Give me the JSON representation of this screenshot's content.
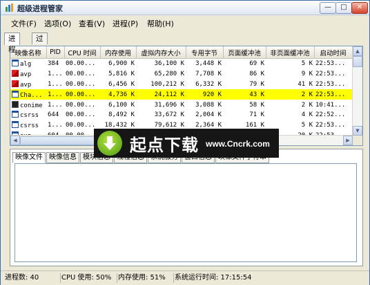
{
  "window": {
    "title": "超级进程管家"
  },
  "menu": [
    "文件(F)",
    "选项(O)",
    "查看(V)",
    "进程(P)",
    "帮助(H)"
  ],
  "tabs": [
    "进程",
    "过滤"
  ],
  "table": {
    "headers": [
      "映像名称",
      "PID",
      "CPU 时间",
      "内存使用",
      "虚拟内存大小",
      "专用字节",
      "页面缓冲池",
      "非页面缓冲池",
      "启动时间"
    ],
    "rows": [
      {
        "name": "alg",
        "pid": "384",
        "cpu": "00.00...",
        "mem": "6,900 K",
        "virt": "36,100 K",
        "priv": "3,448 K",
        "paged": "69 K",
        "nonpaged": "5 K",
        "start": "22:53...",
        "icon": "generic"
      },
      {
        "name": "avp",
        "pid": "1...",
        "cpu": "00.00...",
        "mem": "5,816 K",
        "virt": "65,280 K",
        "priv": "7,708 K",
        "paged": "86 K",
        "nonpaged": "9 K",
        "start": "22:53...",
        "icon": "avp"
      },
      {
        "name": "avp",
        "pid": "1...",
        "cpu": "00.00...",
        "mem": "6,456 K",
        "virt": "100,212 K",
        "priv": "6,332 K",
        "paged": "79 K",
        "nonpaged": "41 K",
        "start": "22:53...",
        "icon": "avp"
      },
      {
        "name": "Cha...",
        "pid": "1...",
        "cpu": "00.00...",
        "mem": "4,736 K",
        "virt": "24,112 K",
        "priv": "920 K",
        "paged": "43 K",
        "nonpaged": "2 K",
        "start": "22:53...",
        "icon": "generic",
        "selected": true
      },
      {
        "name": "conime",
        "pid": "1...",
        "cpu": "00.00...",
        "mem": "6,100 K",
        "virt": "31,696 K",
        "priv": "3,088 K",
        "paged": "58 K",
        "nonpaged": "2 K",
        "start": "10:41...",
        "icon": "conime"
      },
      {
        "name": "csrss",
        "pid": "644",
        "cpu": "00.00...",
        "mem": "8,492 K",
        "virt": "33,672 K",
        "priv": "2,004 K",
        "paged": "71 K",
        "nonpaged": "4 K",
        "start": "22:52...",
        "icon": "generic"
      },
      {
        "name": "csrss",
        "pid": "1...",
        "cpu": "00.00...",
        "mem": "18,432 K",
        "virt": "79,612 K",
        "priv": "2,364 K",
        "paged": "161 K",
        "nonpaged": "5 K",
        "start": "22:53...",
        "icon": "generic"
      },
      {
        "name": "exp...",
        "pid": "604",
        "cpu": "00.00...",
        "mem": "",
        "virt": "",
        "priv": "",
        "paged": "",
        "nonpaged": "20 K",
        "start": "22:53...",
        "icon": "generic"
      }
    ]
  },
  "lower_tabs": [
    "映像文件",
    "映像信息",
    "模块信息",
    "线程信息",
    "系统服务",
    "窗口信息",
    "映像文件字符串"
  ],
  "status": {
    "processes": "进程数: 40",
    "cpu": "CPU 使用: 50%",
    "memory": "内存使用: 51%",
    "uptime": "系统运行时间: 17:15:54"
  },
  "banner": {
    "brand": "起点下载",
    "url": "www.Cncrk.com"
  },
  "colors": {
    "selected_row": "#ffff00",
    "title_gradient": "#dfe6f2",
    "banner_bg": "#161616"
  },
  "icons": {
    "app": "app-icon",
    "window_buttons": [
      "minimize-icon",
      "maximize-icon",
      "close-icon"
    ]
  }
}
